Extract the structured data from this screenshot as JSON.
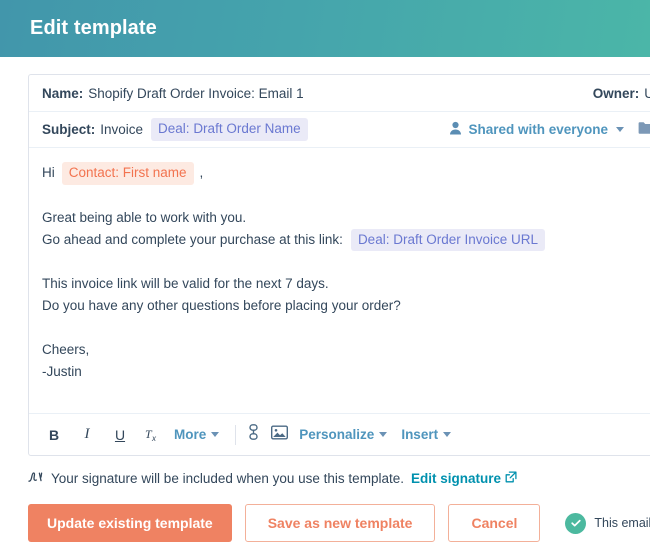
{
  "header": {
    "title": "Edit template",
    "gradient_from": "#4296ab",
    "gradient_to": "#4bb6a8"
  },
  "fields": {
    "name_label": "Name:",
    "name_value": "Shopify Draft Order Invoice: Email 1",
    "owner_label": "Owner:",
    "owner_value": "U",
    "subject_label": "Subject:",
    "subject_value": "Invoice",
    "subject_token": "Deal: Draft Order Name",
    "sharing_label": "Shared with everyone",
    "person_icon": "person-icon",
    "caret_icon": "chevron-down-icon",
    "folder_icon": "folder-icon"
  },
  "body": {
    "greeting_prefix": "Hi",
    "greeting_token": "Contact: First name",
    "greeting_suffix": ",",
    "line1": "Great being able to work with you.",
    "line2": "Go ahead and complete your purchase at this link:",
    "line2_token": "Deal: Draft Order Invoice URL",
    "line3": "This invoice link will be valid for the next 7 days.",
    "line4": "Do you have any other questions before placing your order?",
    "signoff1": "Cheers,",
    "signoff2": "-Justin"
  },
  "toolbar": {
    "bold": "B",
    "italic": "I",
    "underline": "U",
    "clear_format": "Tx",
    "more": "More",
    "link_icon": "link-icon",
    "image_icon": "image-icon",
    "personalize": "Personalize",
    "insert": "Insert"
  },
  "signature": {
    "icon": "signature-icon",
    "text": "Your signature will be included when you use this template.",
    "link": "Edit signature",
    "external_icon": "external-link-icon"
  },
  "footer": {
    "update_label": "Update existing template",
    "save_new_label": "Save as new template",
    "cancel_label": "Cancel",
    "status_text": "This email looks fantastic!",
    "status_icon": "check-circle-icon",
    "primary_color": "#ef8262",
    "status_color": "#4cb99f"
  }
}
